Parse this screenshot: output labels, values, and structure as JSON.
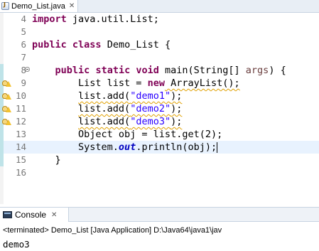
{
  "editor_tab": {
    "filename": "Demo_List.java",
    "close": "✕"
  },
  "editor": {
    "current_line": 14,
    "lines": [
      {
        "num": "4",
        "tokens": [
          {
            "t": "import",
            "c": "kw"
          },
          {
            "t": " java.util.List;"
          }
        ]
      },
      {
        "num": "5",
        "tokens": []
      },
      {
        "num": "6",
        "tokens": [
          {
            "t": "public",
            "c": "kw"
          },
          {
            "t": " "
          },
          {
            "t": "class",
            "c": "kw"
          },
          {
            "t": " Demo_List {"
          }
        ]
      },
      {
        "num": "7",
        "tokens": []
      },
      {
        "num": "8",
        "fold": true,
        "tokens": [
          {
            "t": "    "
          },
          {
            "t": "public",
            "c": "kw"
          },
          {
            "t": " "
          },
          {
            "t": "static",
            "c": "kw"
          },
          {
            "t": " "
          },
          {
            "t": "void",
            "c": "kw"
          },
          {
            "t": " main(String[] "
          },
          {
            "t": "args",
            "c": "par"
          },
          {
            "t": ") {"
          }
        ]
      },
      {
        "num": "9",
        "warn": true,
        "tokens": [
          {
            "t": "        List list = "
          },
          {
            "t": "new",
            "c": "kw"
          },
          {
            "t": " ArrayList();",
            "c": "wavy"
          }
        ]
      },
      {
        "num": "10",
        "warn": true,
        "tokens": [
          {
            "t": "        "
          },
          {
            "t": "list.add(",
            "c": "wavy"
          },
          {
            "t": "\"demo1\"",
            "c": "str wavy"
          },
          {
            "t": ");",
            "c": "wavy"
          }
        ]
      },
      {
        "num": "11",
        "warn": true,
        "tokens": [
          {
            "t": "        "
          },
          {
            "t": "list.add(",
            "c": "wavy"
          },
          {
            "t": "\"demo2\"",
            "c": "str wavy"
          },
          {
            "t": ");",
            "c": "wavy"
          }
        ]
      },
      {
        "num": "12",
        "warn": true,
        "tokens": [
          {
            "t": "        "
          },
          {
            "t": "list.add(",
            "c": "wavy"
          },
          {
            "t": "\"demo3\"",
            "c": "str wavy"
          },
          {
            "t": ");",
            "c": "wavy"
          }
        ]
      },
      {
        "num": "13",
        "tokens": [
          {
            "t": "        Object obj = list.get(2);"
          }
        ]
      },
      {
        "num": "14",
        "tokens": [
          {
            "t": "        System."
          },
          {
            "t": "out",
            "c": "fld"
          },
          {
            "t": ".println(obj);"
          }
        ],
        "caret": true
      },
      {
        "num": "15",
        "tokens": [
          {
            "t": "    }"
          }
        ]
      },
      {
        "num": "16",
        "tokens": []
      }
    ]
  },
  "console": {
    "tab_label": "Console",
    "close": "✕",
    "status": "<terminated> Demo_List [Java Application] D:\\Java64\\java1\\jav",
    "output": "demo3"
  },
  "colors": {
    "keyword": "#7f0055",
    "string": "#2a00ff",
    "static_field": "#0000c0",
    "parameter": "#6a3e3e",
    "current_line": "#e8f2fe"
  }
}
